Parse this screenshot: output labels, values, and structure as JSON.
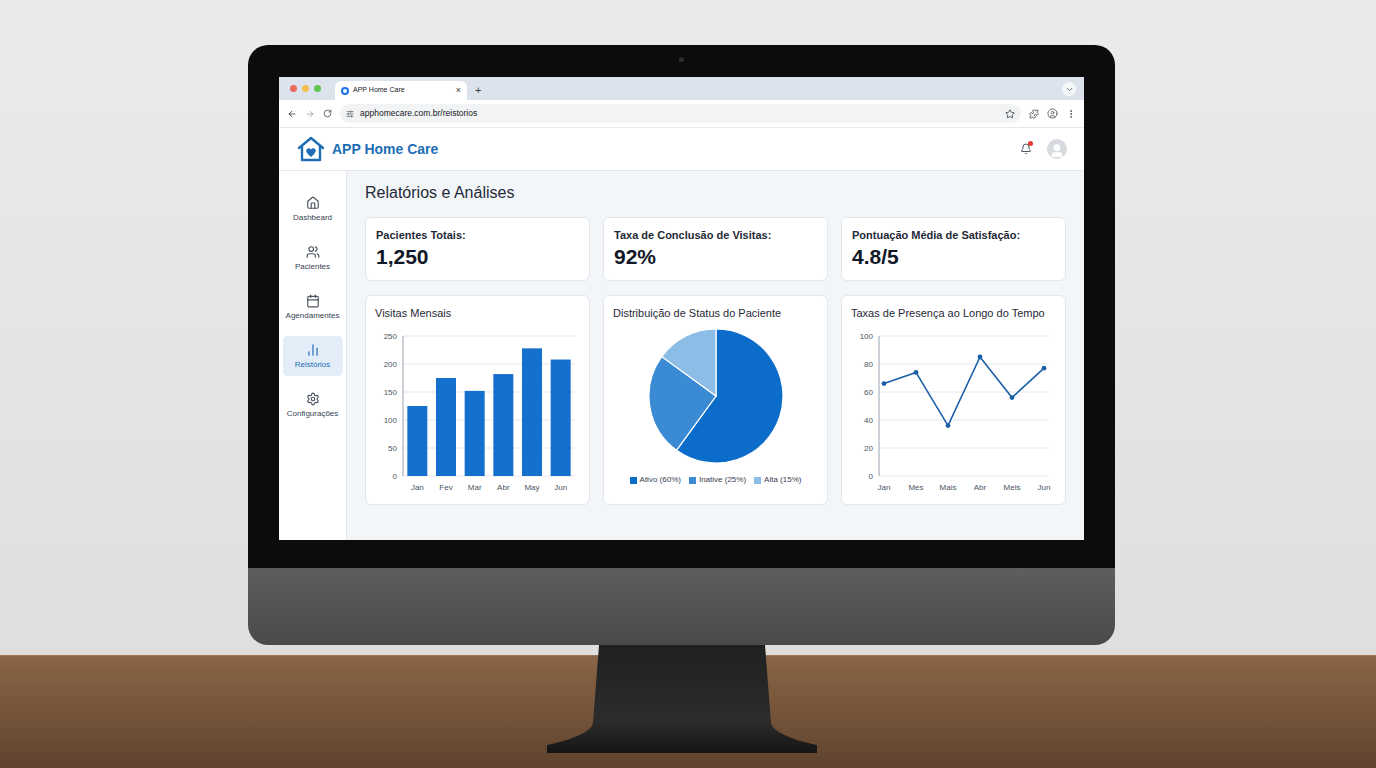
{
  "browser": {
    "tab_title": "APP Home Care",
    "tab_close": "×",
    "new_tab": "+",
    "url": "apphomecare.com.br/reistorios"
  },
  "app": {
    "name": "APP Home Care",
    "unread_notifications": true
  },
  "sidebar": {
    "items": [
      {
        "label": "Dashbeard",
        "selected": false
      },
      {
        "label": "Pacientes",
        "selected": false
      },
      {
        "label": "Agendamentes",
        "selected": false
      },
      {
        "label": "Relstórios",
        "selected": true
      },
      {
        "label": "Configurações",
        "selected": false
      }
    ]
  },
  "page": {
    "title": "Relatórios e Análises"
  },
  "stats": [
    {
      "label": "Pacientes Totais:",
      "value": "1,250"
    },
    {
      "label": "Taxa de Conclusão de Visitas:",
      "value": "92%"
    },
    {
      "label": "Pontuação Média de Satisfação:",
      "value": "4.8/5"
    }
  ],
  "charts": {
    "monthly_visits": {
      "title": "Visitas Mensais",
      "y_ticks": [
        "0",
        "50",
        "100",
        "150",
        "200",
        "250"
      ],
      "x_labels": [
        "Jan",
        "Fev",
        "Mar",
        "Abr",
        "May",
        "Jun"
      ],
      "values": [
        125,
        175,
        152,
        182,
        228,
        208
      ]
    },
    "patient_status": {
      "title": "Distribuição de Status do Paciente",
      "slices": [
        {
          "label": "Ativo (60%)",
          "value": 60,
          "color": "#0b6dc9"
        },
        {
          "label": "Inative (25%)",
          "value": 25,
          "color": "#3a8ad4"
        },
        {
          "label": "Alta (15%)",
          "value": 15,
          "color": "#8cbde6"
        }
      ]
    },
    "attendance": {
      "title": "Taxas de Presença ao Longo do Tempo",
      "y_ticks": [
        "0",
        "20",
        "40",
        "60",
        "80",
        "100"
      ],
      "x_labels": [
        "Jan",
        "Mes",
        "Mais",
        "Abr",
        "Mels",
        "Jun"
      ],
      "values": [
        66,
        74,
        36,
        85,
        56,
        77
      ]
    }
  }
}
